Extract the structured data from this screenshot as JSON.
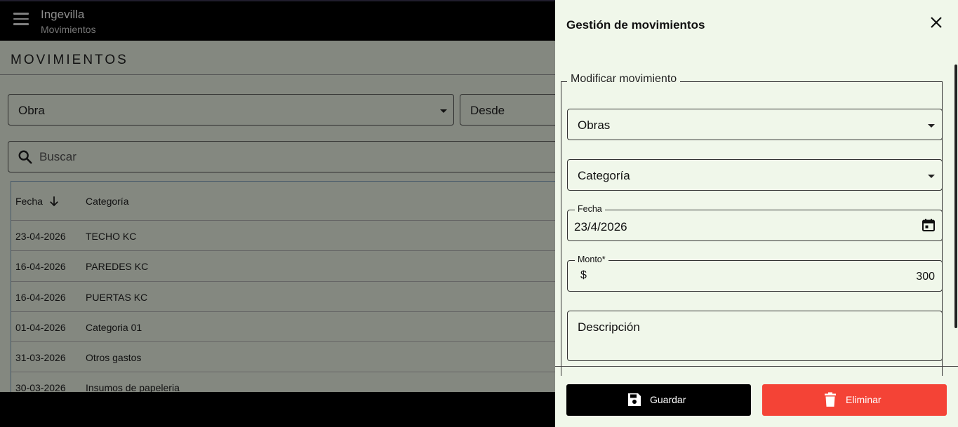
{
  "app": {
    "title": "Ingevilla",
    "subtitle": "Movimientos"
  },
  "page": {
    "section_title": "MOVIMIENTOS"
  },
  "filters": {
    "obra_label": "Obra",
    "desde_label": "Desde"
  },
  "search": {
    "placeholder": "Buscar"
  },
  "table": {
    "headers": {
      "fecha": "Fecha",
      "categoria": "Categoría"
    },
    "rows": [
      {
        "fecha": "23-04-2026",
        "categoria": "TECHO KC"
      },
      {
        "fecha": "16-04-2026",
        "categoria": "PAREDES KC"
      },
      {
        "fecha": "16-04-2026",
        "categoria": "PUERTAS KC"
      },
      {
        "fecha": "01-04-2026",
        "categoria": "Categoria 01"
      },
      {
        "fecha": "31-03-2026",
        "categoria": "Otros gastos"
      },
      {
        "fecha": "30-03-2026",
        "categoria": "Insumos de papeleria"
      }
    ]
  },
  "drawer": {
    "title": "Gestión de movimientos",
    "legend": "Modificar movimiento",
    "obras_value": "Obras",
    "categoria_value": "Categoría",
    "fecha_label": "Fecha",
    "fecha_value": "23/4/2026",
    "monto_label": "Monto*",
    "monto_currency": "$",
    "monto_value": "300",
    "descripcion_placeholder": "Descripción",
    "save_label": "Guardar",
    "delete_label": "Eliminar"
  },
  "colors": {
    "accent_delete": "#f44336",
    "save_button": "#000000",
    "drawer_bg": "#f0f7ea"
  }
}
